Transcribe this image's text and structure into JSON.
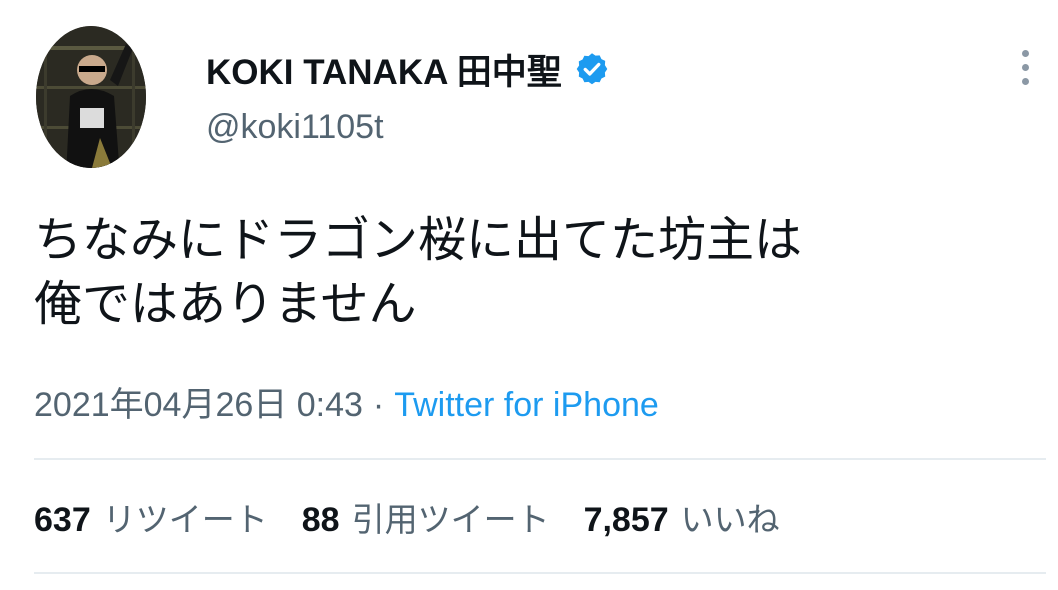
{
  "author": {
    "display_name": "KOKI TANAKA 田中聖",
    "handle": "@koki1105t",
    "verified": true,
    "avatar_icon": "profile-photo"
  },
  "tweet": {
    "text": "ちなみにドラゴン桜に出てた坊主は\n俺ではありません",
    "timestamp": "2021年04月26日 0:43",
    "separator": "·",
    "source": "Twitter for iPhone"
  },
  "stats": {
    "retweets": {
      "count": "637",
      "label": "リツイート"
    },
    "quotes": {
      "count": "88",
      "label": "引用ツイート"
    },
    "likes": {
      "count": "7,857",
      "label": "いいね"
    }
  },
  "colors": {
    "link": "#1d9bf0",
    "secondary_text": "#536471",
    "primary_text": "#0f1419",
    "verified_badge": "#1d9bf0",
    "divider": "#e6ecf0"
  }
}
